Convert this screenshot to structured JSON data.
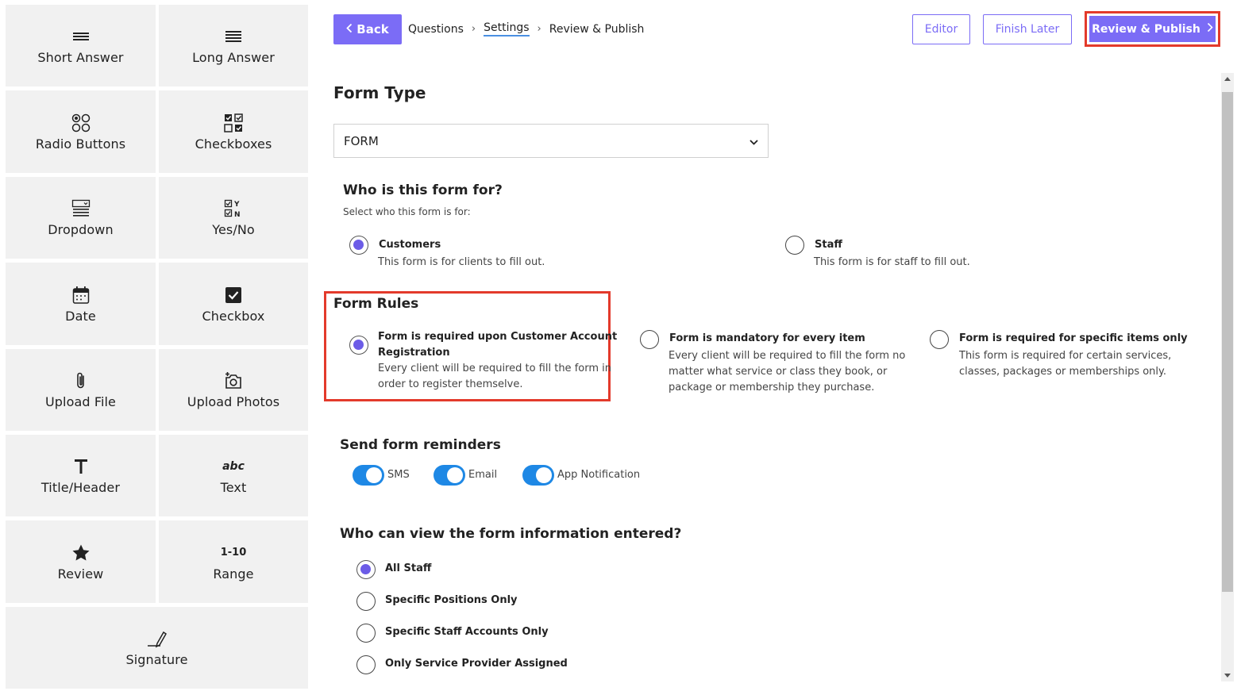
{
  "palette": {
    "short_answer": "Short Answer",
    "long_answer": "Long Answer",
    "radio_buttons": "Radio Buttons",
    "checkboxes": "Checkboxes",
    "dropdown": "Dropdown",
    "yes_no": "Yes/No",
    "date": "Date",
    "checkbox": "Checkbox",
    "upload_file": "Upload File",
    "upload_photos": "Upload Photos",
    "title_header": "Title/Header",
    "text": "Text",
    "text_icon": "abc",
    "review": "Review",
    "range": "Range",
    "range_icon": "1-10",
    "signature": "Signature"
  },
  "header": {
    "back": "Back",
    "crumbs": [
      "Questions",
      "Settings",
      "Review & Publish"
    ],
    "editor": "Editor",
    "finish_later": "Finish Later",
    "review_publish": "Review & Publish"
  },
  "form_type": {
    "heading": "Form Type",
    "selected": "FORM"
  },
  "audience": {
    "heading": "Who is this form for?",
    "subheading": "Select who this form is for:",
    "options": [
      {
        "title": "Customers",
        "desc": "This form is for clients to fill out.",
        "selected": true
      },
      {
        "title": "Staff",
        "desc": "This form is for staff to fill out.",
        "selected": false
      }
    ]
  },
  "rules": {
    "heading": "Form Rules",
    "options": [
      {
        "title1": "Form is required upon Customer Account",
        "title2": "Registration",
        "desc1": "Every client will be required to fill the form in",
        "desc2": "order to register themselve.",
        "selected": true
      },
      {
        "title1": "Form is mandatory for every item",
        "desc1": "Every client will be required to fill the form no",
        "desc2": "matter what service or class they book, or",
        "desc3": "package or membership they purchase.",
        "selected": false
      },
      {
        "title1": "Form is required for specific items only",
        "desc1": "This form is required for certain services,",
        "desc2": "classes, packages or memberships only.",
        "selected": false
      }
    ]
  },
  "reminders": {
    "heading": "Send form reminders",
    "sms": "SMS",
    "email": "Email",
    "app": "App Notification"
  },
  "visibility": {
    "heading": "Who can view the form information entered?",
    "options": [
      "All Staff",
      "Specific Positions Only",
      "Specific Staff Accounts Only",
      "Only Service Provider Assigned"
    ]
  },
  "colors": {
    "accent": "#7b6cf6",
    "toggle": "#1e88e5",
    "highlight": "#e33a2b"
  }
}
